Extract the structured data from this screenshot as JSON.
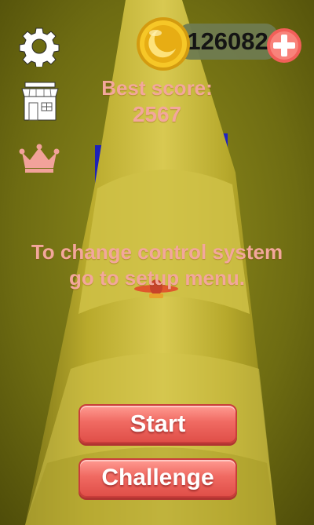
{
  "hud": {
    "coins": "-126082",
    "best_score_label": "Best score:",
    "best_score_value": "2567",
    "settings_icon": "gear-icon",
    "shop_icon": "shop-icon",
    "crown_icon": "crown-icon",
    "coin_icon": "coin-icon",
    "add_icon": "plus-icon"
  },
  "message": {
    "line1": "To change control system",
    "line2": "go to setup menu."
  },
  "buttons": {
    "start": "Start",
    "challenge": "Challenge"
  },
  "colors": {
    "background": "#6d6b10",
    "tube": "#c9bd3c",
    "accent_pink": "#f3a79c",
    "button_red": "#f06a62",
    "block_blue": "#1d22b8"
  }
}
